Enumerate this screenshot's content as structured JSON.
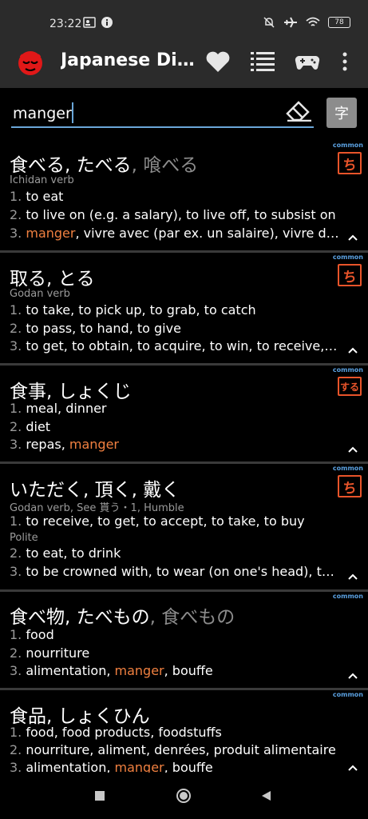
{
  "status": {
    "time": "23:22",
    "battery": "78"
  },
  "app": {
    "title": "Japanese Dictionary"
  },
  "search": {
    "value": "manger",
    "kanji_button": "字"
  },
  "entries": [
    {
      "headword": "食べる, たべる",
      "alt": ", 喰べる",
      "pos": "Ichidan verb",
      "common": "common",
      "stamp": "ち",
      "senses": [
        {
          "num": "1.",
          "text": " to eat"
        },
        {
          "num": "2.",
          "text": " to live on (e.g. a salary), to live off, to subsist on"
        },
        {
          "num": "3.",
          "pre": " ",
          "hl": "manger",
          "post": ", vivre avec (par ex. un salaire), vivre de..."
        }
      ]
    },
    {
      "headword": "取る, とる",
      "alt": "",
      "pos": "Godan verb",
      "common": "common",
      "stamp": "ち",
      "senses": [
        {
          "num": "1.",
          "text": " to take, to pick up, to grab, to catch"
        },
        {
          "num": "2.",
          "text": " to pass, to hand, to give"
        },
        {
          "num": "3.",
          "text": " to get, to obtain, to acquire, to win, to receive, t..."
        }
      ]
    },
    {
      "headword": "食事, しょくじ",
      "alt": "",
      "pos": "",
      "common": "common",
      "stamp": "する",
      "senses": [
        {
          "num": "1.",
          "text": " meal, dinner"
        },
        {
          "num": "2.",
          "text": " diet"
        },
        {
          "num": "3.",
          "pre": " repas, ",
          "hl": "manger",
          "post": ""
        }
      ]
    },
    {
      "headword": "いただく, 頂く, 戴く",
      "alt": "",
      "pos": "Godan verb, See 貰う・1, Humble",
      "pos2": "Polite",
      "common": "common",
      "stamp": "ち",
      "senses": [
        {
          "num": "1.",
          "text": " to receive, to get, to accept, to take, to buy"
        },
        {
          "num": "2.",
          "text": " to eat, to drink"
        },
        {
          "num": "3.",
          "text": " to be crowned with, to wear (on one's head), to..."
        }
      ]
    },
    {
      "headword": "食べ物, たべもの",
      "alt": ", 食べもの",
      "pos": "",
      "common": "common",
      "stamp": "",
      "senses": [
        {
          "num": "1.",
          "text": " food"
        },
        {
          "num": "2.",
          "text": " nourriture"
        },
        {
          "num": "3.",
          "pre": " alimentation, ",
          "hl": "manger",
          "post": ", bouffe"
        }
      ]
    },
    {
      "headword": "食品, しょくひん",
      "alt": "",
      "pos": "",
      "common": "common",
      "stamp": "",
      "senses": [
        {
          "num": "1.",
          "text": " food, food products, foodstuffs"
        },
        {
          "num": "2.",
          "text": " nourriture, aliment, denrées, produit alimentaire"
        },
        {
          "num": "3.",
          "pre": " alimentation, ",
          "hl": "manger",
          "post": ", bouffe"
        }
      ]
    }
  ],
  "colors": {
    "accent": "#6aa6d8",
    "highlight": "#f08040",
    "stamp": "#e8542a",
    "bar": "#2b2b2b"
  },
  "icons": [
    "app-logo",
    "heart-icon",
    "list-icon",
    "gamepad-icon",
    "more-vert-icon",
    "eraser-icon",
    "chevron-up-icon",
    "square-icon",
    "circle-icon",
    "back-triangle-icon"
  ]
}
